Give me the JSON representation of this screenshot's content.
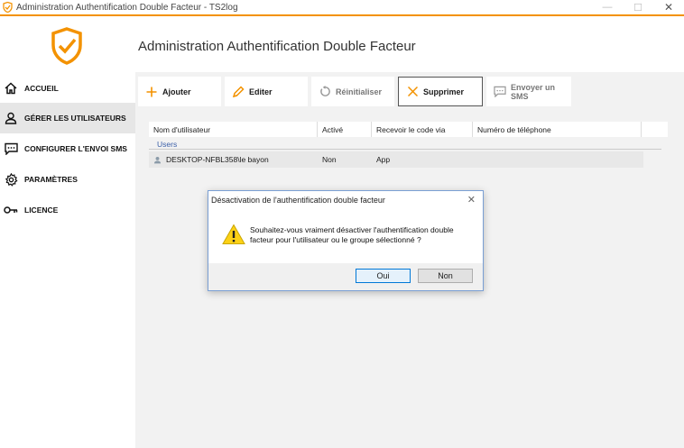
{
  "window": {
    "title": "Administration Authentification Double Facteur - TS2log",
    "controls": {
      "minimize": "—",
      "maximize": "☐",
      "close": "✕"
    }
  },
  "colors": {
    "accent": "#f39200",
    "link_blue": "#3a5fa8",
    "dialog_border": "#7a9fd4"
  },
  "sidebar": {
    "logo_icon": "shield-check-icon",
    "items": [
      {
        "label": "ACCUEIL",
        "icon": "home-icon"
      },
      {
        "label": "GÉRER LES UTILISATEURS",
        "icon": "user-icon",
        "active": true
      },
      {
        "label": "CONFIGURER L'ENVOI SMS",
        "icon": "message-icon"
      },
      {
        "label": "PARAMÈTRES",
        "icon": "gear-icon"
      },
      {
        "label": "LICENCE",
        "icon": "key-icon"
      }
    ]
  },
  "main": {
    "title": "Administration Authentification Double Facteur",
    "toolbar": {
      "add": "Ajouter",
      "edit": "Editer",
      "reset": "Réinitialiser",
      "delete": "Supprimer",
      "sms": "Envoyer un SMS"
    },
    "grid": {
      "columns": [
        "Nom d'utilisateur",
        "Activé",
        "Recevoir le code via",
        "Numéro de téléphone"
      ],
      "group": "Users",
      "rows": [
        {
          "username": "DESKTOP-NFBL358\\le bayon",
          "enabled": "Non",
          "via": "App",
          "phone": ""
        }
      ]
    }
  },
  "dialog": {
    "title": "Désactivation de l'authentification double facteur",
    "close": "✕",
    "message": "Souhaitez-vous vraiment désactiver l'authentification double facteur pour l'utilisateur ou le groupe sélectionné ?",
    "yes": "Oui",
    "no": "Non"
  }
}
